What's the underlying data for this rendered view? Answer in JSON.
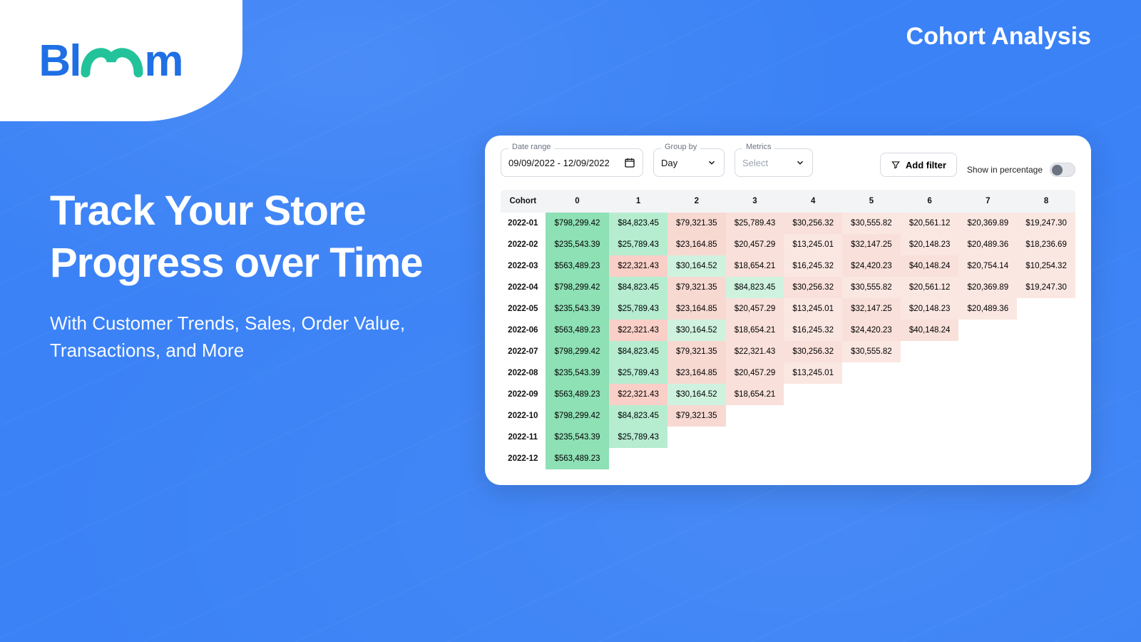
{
  "brand": "Bloom",
  "page_title": "Cohort Analysis",
  "headline": "Track Your  Store Progress over Time",
  "subhead": "With Customer Trends, Sales, Order Value, Transactions, and More",
  "controls": {
    "date_range": {
      "label": "Date range",
      "value": "09/09/2022 - 12/09/2022"
    },
    "group_by": {
      "label": "Group by",
      "value": "Day"
    },
    "metrics": {
      "label": "Metrics",
      "placeholder": "Select"
    },
    "add_filter": "Add filter",
    "percentage_label": "Show in percentage"
  },
  "table": {
    "header_label": "Cohort",
    "period_headers": [
      "0",
      "1",
      "2",
      "3",
      "4",
      "5",
      "6",
      "7",
      "8"
    ],
    "rows": [
      {
        "cohort": "2022-01",
        "cells": [
          {
            "v": "$798,299.42",
            "c": "c0"
          },
          {
            "v": "$84,823.45",
            "c": "c1"
          },
          {
            "v": "$79,321.35",
            "c": "c2r"
          },
          {
            "v": "$25,789.43",
            "c": "c3"
          },
          {
            "v": "$30,256.32",
            "c": "c3"
          },
          {
            "v": "$30,555.82",
            "c": "c4"
          },
          {
            "v": "$20,561.12",
            "c": "c4"
          },
          {
            "v": "$20,369.89",
            "c": "c4"
          },
          {
            "v": "$19,247.30",
            "c": "c4"
          }
        ]
      },
      {
        "cohort": "2022-02",
        "cells": [
          {
            "v": "$235,543.39",
            "c": "c0"
          },
          {
            "v": "$25,789.43",
            "c": "c1"
          },
          {
            "v": "$23,164.85",
            "c": "c2r"
          },
          {
            "v": "$20,457.29",
            "c": "c3"
          },
          {
            "v": "$13,245.01",
            "c": "c4"
          },
          {
            "v": "$32,147.25",
            "c": "c3"
          },
          {
            "v": "$20,148.23",
            "c": "c4"
          },
          {
            "v": "$20,489.36",
            "c": "c4"
          },
          {
            "v": "$18,236.69",
            "c": "c4"
          }
        ]
      },
      {
        "cohort": "2022-03",
        "cells": [
          {
            "v": "$563,489.23",
            "c": "c0"
          },
          {
            "v": "$22,321.43",
            "c": "c1r"
          },
          {
            "v": "$30,164.52",
            "c": "c2g"
          },
          {
            "v": "$18,654.21",
            "c": "c3"
          },
          {
            "v": "$16,245.32",
            "c": "c4"
          },
          {
            "v": "$24,420.23",
            "c": "c3"
          },
          {
            "v": "$40,148.24",
            "c": "c3"
          },
          {
            "v": "$20,754.14",
            "c": "c4"
          },
          {
            "v": "$10,254.32",
            "c": "c4"
          }
        ]
      },
      {
        "cohort": "2022-04",
        "cells": [
          {
            "v": "$798,299.42",
            "c": "c0"
          },
          {
            "v": "$84,823.45",
            "c": "c1"
          },
          {
            "v": "$79,321.35",
            "c": "c2r"
          },
          {
            "v": "$84,823.45",
            "c": "c2g"
          },
          {
            "v": "$30,256.32",
            "c": "c3"
          },
          {
            "v": "$30,555.82",
            "c": "c4"
          },
          {
            "v": "$20,561.12",
            "c": "c4"
          },
          {
            "v": "$20,369.89",
            "c": "c4"
          },
          {
            "v": "$19,247.30",
            "c": "c4"
          }
        ]
      },
      {
        "cohort": "2022-05",
        "cells": [
          {
            "v": "$235,543.39",
            "c": "c0"
          },
          {
            "v": "$25,789.43",
            "c": "c1"
          },
          {
            "v": "$23,164.85",
            "c": "c2r"
          },
          {
            "v": "$20,457.29",
            "c": "c3"
          },
          {
            "v": "$13,245.01",
            "c": "c4"
          },
          {
            "v": "$32,147.25",
            "c": "c3"
          },
          {
            "v": "$20,148.23",
            "c": "c4"
          },
          {
            "v": "$20,489.36",
            "c": "c4"
          }
        ]
      },
      {
        "cohort": "2022-06",
        "cells": [
          {
            "v": "$563,489.23",
            "c": "c0"
          },
          {
            "v": "$22,321.43",
            "c": "c1r"
          },
          {
            "v": "$30,164.52",
            "c": "c2g"
          },
          {
            "v": "$18,654.21",
            "c": "c3"
          },
          {
            "v": "$16,245.32",
            "c": "c4"
          },
          {
            "v": "$24,420.23",
            "c": "c3"
          },
          {
            "v": "$40,148.24",
            "c": "c3"
          }
        ]
      },
      {
        "cohort": "2022-07",
        "cells": [
          {
            "v": "$798,299.42",
            "c": "c0"
          },
          {
            "v": "$84,823.45",
            "c": "c1"
          },
          {
            "v": "$79,321.35",
            "c": "c2r"
          },
          {
            "v": "$22,321.43",
            "c": "c3"
          },
          {
            "v": "$30,256.32",
            "c": "c3"
          },
          {
            "v": "$30,555.82",
            "c": "c4"
          }
        ]
      },
      {
        "cohort": "2022-08",
        "cells": [
          {
            "v": "$235,543.39",
            "c": "c0"
          },
          {
            "v": "$25,789.43",
            "c": "c1"
          },
          {
            "v": "$23,164.85",
            "c": "c2r"
          },
          {
            "v": "$20,457.29",
            "c": "c3"
          },
          {
            "v": "$13,245.01",
            "c": "c4"
          }
        ]
      },
      {
        "cohort": "2022-09",
        "cells": [
          {
            "v": "$563,489.23",
            "c": "c0"
          },
          {
            "v": "$22,321.43",
            "c": "c1r"
          },
          {
            "v": "$30,164.52",
            "c": "c2g"
          },
          {
            "v": "$18,654.21",
            "c": "c3"
          }
        ]
      },
      {
        "cohort": "2022-10",
        "cells": [
          {
            "v": "$798,299.42",
            "c": "c0"
          },
          {
            "v": "$84,823.45",
            "c": "c1"
          },
          {
            "v": "$79,321.35",
            "c": "c2r"
          }
        ]
      },
      {
        "cohort": "2022-11",
        "cells": [
          {
            "v": "$235,543.39",
            "c": "c0"
          },
          {
            "v": "$25,789.43",
            "c": "c1"
          }
        ]
      },
      {
        "cohort": "2022-12",
        "cells": [
          {
            "v": "$563,489.23",
            "c": "c0"
          }
        ]
      }
    ]
  }
}
